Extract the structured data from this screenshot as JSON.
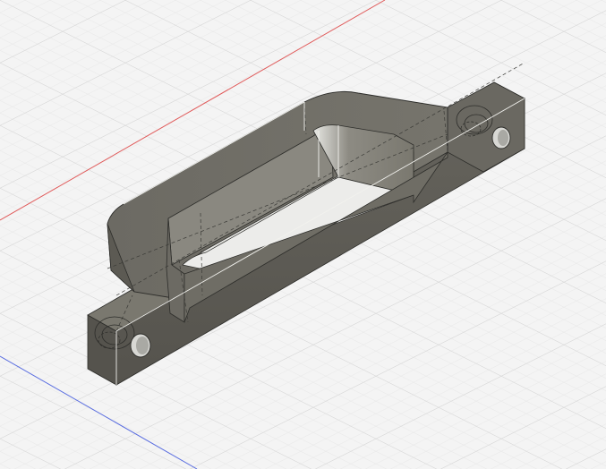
{
  "viewport": {
    "background": "#f4f4f4",
    "grid_minor_color": "#e3e3e3",
    "grid_major_color": "#cfcfcf",
    "axis_x_color": "#e05a5a",
    "axis_z_color": "#5a6ee0"
  },
  "model": {
    "body_color": "#7c7a72",
    "top_color": "#6e6c64",
    "side_color": "#5e5c55",
    "end_color": "#4f4e48",
    "inner_wall_color": "#8a8880",
    "inner_highlight_color": "#e9e9e6",
    "edge_color": "#2d2d2a",
    "hidden_edge_color": "#3a3a36",
    "hole_color": "#d8d8d4"
  }
}
